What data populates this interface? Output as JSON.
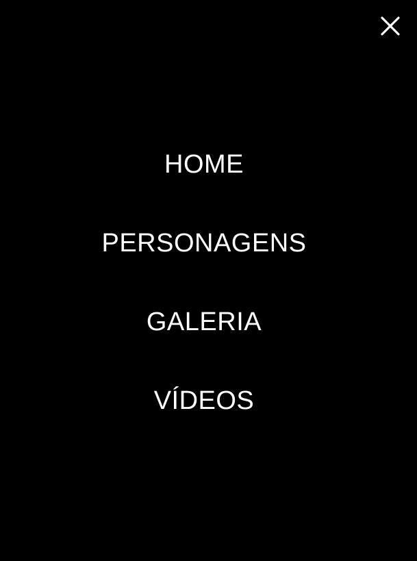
{
  "nav": {
    "close_icon": "close-icon",
    "items": [
      {
        "label": "HOME"
      },
      {
        "label": "PERSONAGENS"
      },
      {
        "label": "GALERIA"
      },
      {
        "label": "VÍDEOS"
      }
    ]
  },
  "colors": {
    "background": "#000000",
    "text": "#ffffff"
  }
}
